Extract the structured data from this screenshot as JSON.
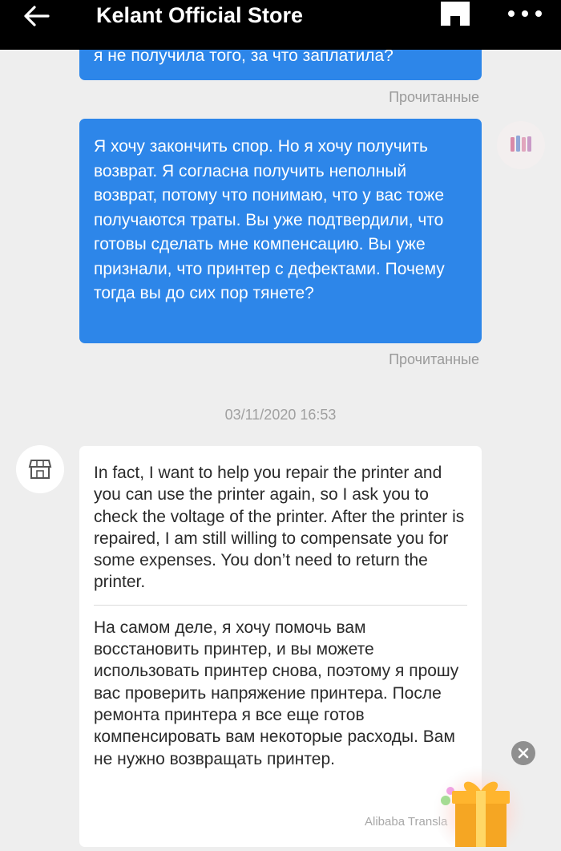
{
  "header": {
    "title": "Kelant Official Store",
    "back_icon": "arrow-left-icon",
    "store_icon": "store-icon",
    "more_icon": "more-dots-icon"
  },
  "messages": {
    "outgoing_1": {
      "text": "я не получила того, за что заплатила?",
      "status": "Прочитанные"
    },
    "outgoing_2": {
      "text": "Я хочу закончить спор. Но я хочу получить возврат. Я согласна получить неполный возврат, потому что понимаю, что у вас тоже получаются траты. Вы уже подтвердили, что готовы сделать мне компенсацию. Вы уже признали, что принтер с дефектами. Почему тогда вы до сих пор тянете?",
      "status": "Прочитанные"
    },
    "date_stamp": "03/11/2020 16:53",
    "incoming_1": {
      "original": "In fact, I want to help you repair the printer and you can use the printer again, so I ask you to check the voltage of the printer. After the printer is repaired, I am still willing to compensate you for some expenses. You don’t need to return the printer.",
      "translation": "На самом деле, я хочу помочь вам восстановить принтер, и вы можете использовать принтер снова, поэтому я прошу вас проверить напряжение принтера. После ремонта принтера я все еще готов компенсировать вам некоторые расходы. Вам не нужно возвращать принтер.",
      "translator_label": "Alibaba Transla"
    }
  },
  "floating": {
    "close_icon": "close-icon",
    "gift_icon": "gift-box-icon"
  },
  "colors": {
    "outgoing_bubble": "#2d86e9",
    "background": "#eeeeee",
    "header": "#000000",
    "gift": "#f5a623"
  }
}
